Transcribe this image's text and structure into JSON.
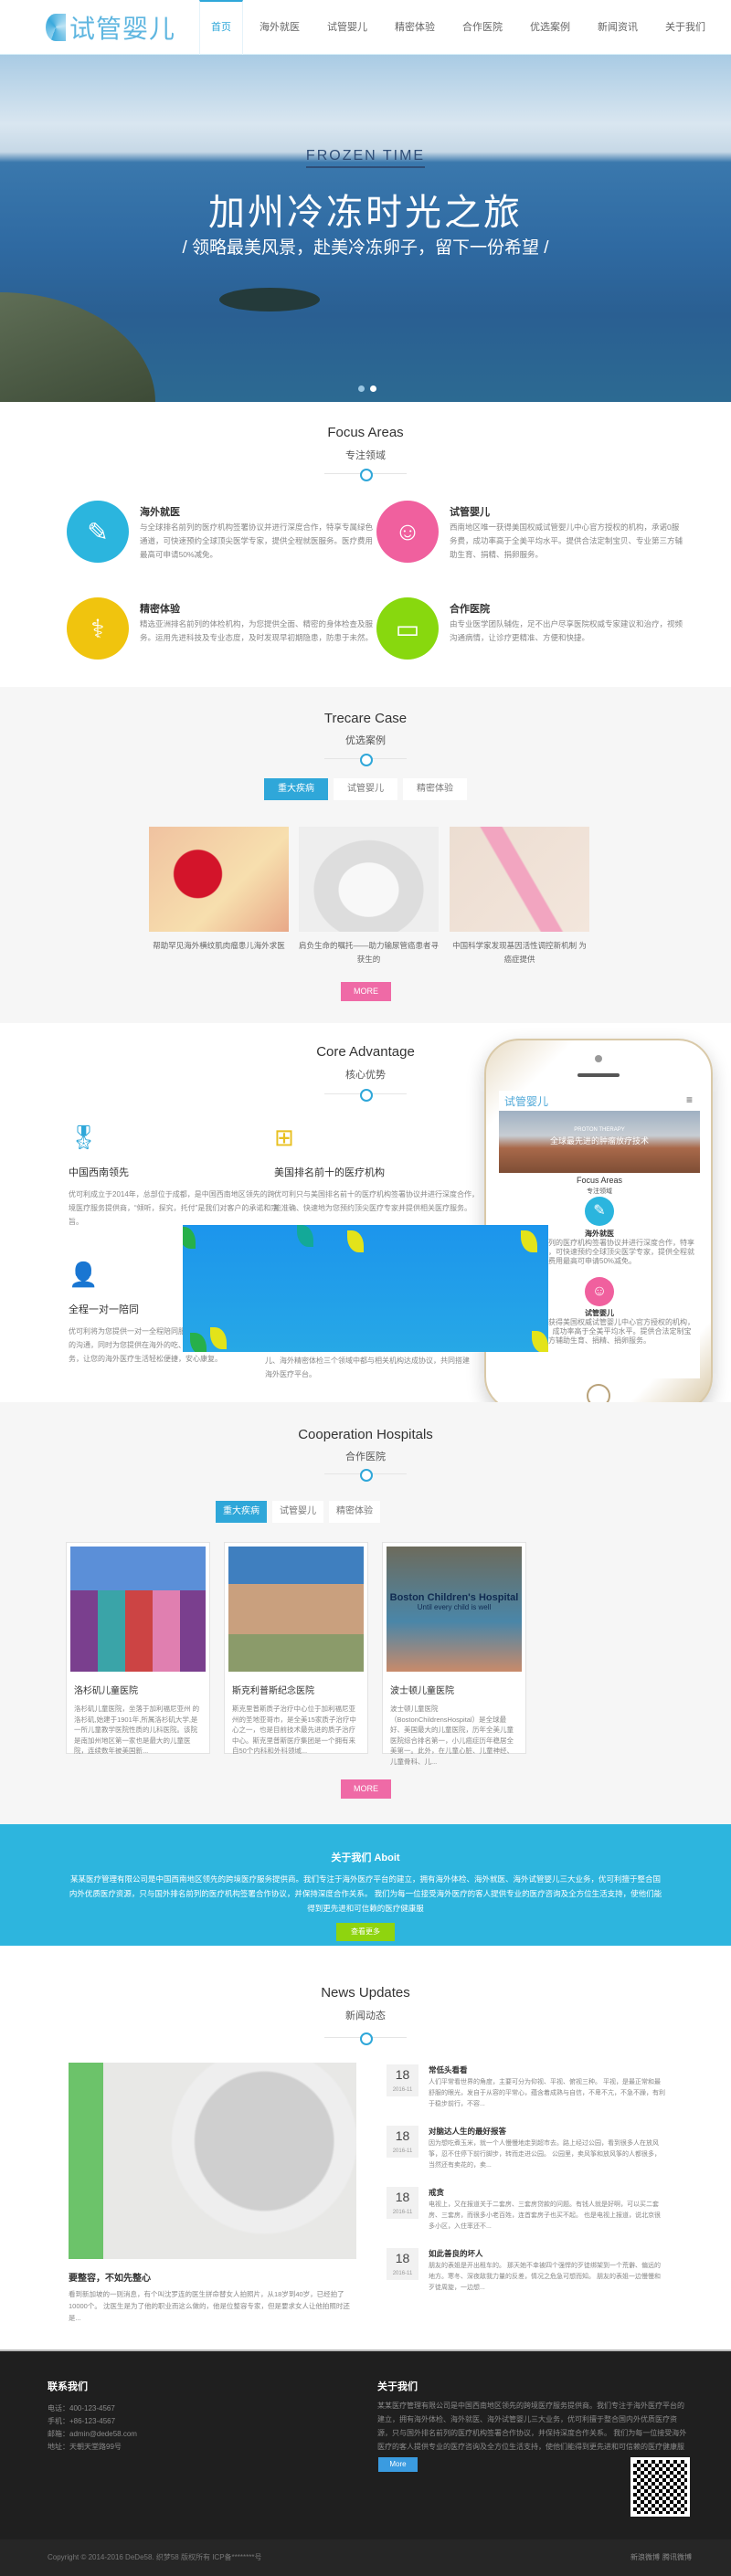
{
  "header": {
    "logo": "试管婴儿",
    "nav": [
      "首页",
      "海外就医",
      "试管婴儿",
      "精密体验",
      "合作医院",
      "优选案例",
      "新闻资讯",
      "关于我们"
    ]
  },
  "hero": {
    "eyebrow": "FROZEN TIME",
    "title": "加州冷冻时光之旅",
    "subtitle": "/ 领略最美风景，赴美冷冻卵子，留下一份希望 /",
    "slides": 2,
    "active_slide": 1
  },
  "focus": {
    "title": "Focus Areas",
    "subtitle": "专注领域",
    "items": [
      {
        "title": "海外就医",
        "text": "与全球排名前列的医疗机构签署协议并进行深度合作，特享专属绿色通道，可快速预约全球顶尖医学专家，提供全程就医服务。医疗费用最高可申请50%减免。",
        "icon": "syringe-icon",
        "color": "#2bb5de"
      },
      {
        "title": "试管婴儿",
        "text": "西南地区唯一获得美国权威试管婴儿中心官方授权的机构，承诺0服务费，成功率高于全美平均水平。提供合法定制宝贝、专业第三方辅助生育、捐精、捐卵服务。",
        "icon": "baby-face-icon",
        "color": "#f0609e"
      },
      {
        "title": "精密体验",
        "text": "精选亚洲排名前列的体检机构，为您提供全面、精密的身体检查及服务。运用先进科技及专业态度，及时发现早初期隐患，防患于未然。",
        "icon": "stethoscope-icon",
        "color": "#f0c40e"
      },
      {
        "title": "合作医院",
        "text": "由专业医学团队辅佐，足不出户尽享医院权威专家建议和治疗，视频沟通病情，让诊疗更精准、方便和快捷。",
        "icon": "monitor-pulse-icon",
        "color": "#88d80e"
      }
    ]
  },
  "cases": {
    "title": "Trecare Case",
    "subtitle": "优选案例",
    "tabs": [
      "重大疾病",
      "试管婴儿",
      "精密体验"
    ],
    "items": [
      "帮助罕见海外横纹肌肉瘤患儿海外求医",
      "肩负生命的嘱托——助力输尿管癌患者寻获生的",
      "中国科学家发现基因活性调控新机制 为癌症提供"
    ],
    "more": "MORE"
  },
  "core": {
    "title": "Core Advantage",
    "subtitle": "核心优势",
    "items": [
      {
        "title": "中国西南领先",
        "text": "优可利成立于2014年，总部位于成都，是中国西南地区领先的跨境医疗服务提供商，“倾听，探究，托付”是我们对客户的承诺和宗旨。"
      },
      {
        "title": "美国排名前十的医疗机构",
        "text": "优可利只与美国排名前十的医疗机构签署协议并进行深度合作，能准确、快速地为您预约顶尖医疗专家并提供相关医疗服务。"
      },
      {
        "title": "全程一对一陪同",
        "text": "优可利将为您提供一对一全程陪同服务，负责您与医疗机构之间的沟通，同时为您提供在海外的吃、住、行等各项生活配套服务，让您的海外医疗生活轻松便捷，安心康复。"
      },
      {
        "title": "",
        "text": "儿、海外精密体检三个领域中都与相关机构达成协议，共同搭建海外医疗平台。"
      }
    ],
    "phone": {
      "logo": "试管婴儿",
      "banner_eyebrow": "PROTON THERAPY",
      "banner_title": "全球最先进的肿瘤放疗技术",
      "section_title": "Focus Areas",
      "section_sub": "专注领域",
      "item1": "海外就医",
      "item1_text": "与全球排名前列的医疗机构签署协议并进行深度合作，特享专属绿色通道，可快速预约全球顶尖医学专家，提供全程就医服务。医疗费用最高可申请50%减免。",
      "item2": "试管婴儿",
      "item2_text": "西南地区唯一获得美国权威试管婴儿中心官方授权的机构，承诺0服务费，成功率高于全美平均水平。提供合法定制宝贝、专业第三方辅助生育、捐精、捐卵服务。"
    }
  },
  "hospitals": {
    "title": "Cooperation Hospitals",
    "subtitle": "合作医院",
    "tabs": [
      "重大疾病",
      "试管婴儿",
      "精密体验"
    ],
    "items": [
      {
        "name": "洛杉矶儿童医院",
        "text": "洛杉矶儿童医院，坐落于加利福尼亚州 的洛杉矶,始建于1901年,所属洛杉矶大学,是一所儿童教学医院性质的儿科医院。该院是南加州地区第一家也是最大的儿童医院，连续数年被美国新..."
      },
      {
        "name": "斯克利普斯纪念医院",
        "text": "斯克里普斯质子治疗中心位于加利福尼亚州的圣地亚哥市，是全美15家质子治疗中心之一，也是目前技术最先进的质子治疗中心。斯克里普斯医疗集团是一个拥有来自50个内科和外科领域..."
      },
      {
        "name": "波士顿儿童医院",
        "text": "波士顿儿童医院（BostonChildrensHospital）是全球最好、美国最大的儿童医院，历年全美儿童医院综合排名第一，小儿癌症历年稳居全美第一。此外，在儿童心脏、儿童神经、儿童骨科、儿...",
        "sign_title": "Boston Children's Hospital",
        "sign_sub": "Until every child is well"
      }
    ],
    "more": "MORE"
  },
  "about": {
    "title": "关于我们  Aboit",
    "text": "某某医疗管理有限公司是中国西南地区领先的跨境医疗服务提供商。我们专注于海外医疗平台的建立，拥有海外体检、海外就医、海外试管婴儿三大业务，优可利擅于整合国内外优质医疗资源，只与国外排名前列的医疗机构签署合作协议，并保持深度合作关系。 我们为每一位接受海外医疗的客人提供专业的医疗咨询及全方位生活支持，使他们能得到更先进和可信赖的医疗健康服",
    "button": "查看更多"
  },
  "news": {
    "title": "News Updates",
    "subtitle": "新闻动态",
    "featured": {
      "title": "要整容，不如先整心",
      "text": "看到新加坡的一则消息，有个叫沈罗连的医生拼命替女人拍照片，从18岁到40岁，已经拍了10000个。 沈医生是为了他的职业而这么做的，他是位整容专家，但是要求女人让他拍照时还是..."
    },
    "items": [
      {
        "day": "18",
        "ym": "2016-11",
        "title": "常低头看看",
        "text": "人们平常看世界的角度，主要可分为仰视、平视、俯视三种。 平视，是最正常和最舒服的眼光，发自于从容的平常心，蕴含着成熟与自信，不卑不亢，不急不躁，有利于稳步前行，不容..."
      },
      {
        "day": "18",
        "ym": "2016-11",
        "title": "对脑达人生的最好报答",
        "text": "因为想吃煮玉米，就一个人慢慢地走到超市去。路上经过公园，看到很多人在放风筝，忍不住停下前行脚步，转而走进公园。 公园里，卖风筝和放风筝的人都很多，当然还有卖花的，卖..."
      },
      {
        "day": "18",
        "ym": "2016-11",
        "title": "戒贪",
        "text": "电视上，又在报道关于二套房、三套房贷款的问题。有钱人就是好啊，可以买二套房、三套房，而很多小老百姓，连首套房子也买不起。 也是电视上报道，说北京很多小区，入住率还不..."
      },
      {
        "day": "18",
        "ym": "2016-11",
        "title": "如此善良的坏人",
        "text": "朋友的表姐是开出租车的。 那天她不幸被四个强悍的歹徒绑架到一个荒僻、偏远的地方。寒冬、深夜敌我力量的反差，情况之危急可想而知。 朋友的表姐一边慢慢和歹徒周旋，一边想..."
      }
    ]
  },
  "footer": {
    "contact_title": "联系我们",
    "contact": [
      "电话：400-123-4567",
      "手机：+86-123-4567",
      "邮箱：admin@dede58.com",
      "地址：天朝天堂路99号"
    ],
    "about_title": "关于我们",
    "about_text": "某某医疗管理有限公司是中国西南地区领先的跨境医疗服务提供商。我们专注于海外医疗平台的建立，拥有海外体检、海外就医、海外试管婴儿三大业务，优可利擅于整合国内外优质医疗资源，只与国外排名前列的医疗机构签署合作协议，并保持深度合作关系。 我们为每一位接受海外医疗的客人提供专业的医疗咨询及全方位生活支持，使他们能得到更先进和可信赖的医疗健康服",
    "more": "More",
    "copyright": "Copyright © 2014-2016 DeDe58. 织梦58 版权所有    ICP备********号",
    "links": [
      "新浪微博",
      "腾讯微博"
    ]
  }
}
